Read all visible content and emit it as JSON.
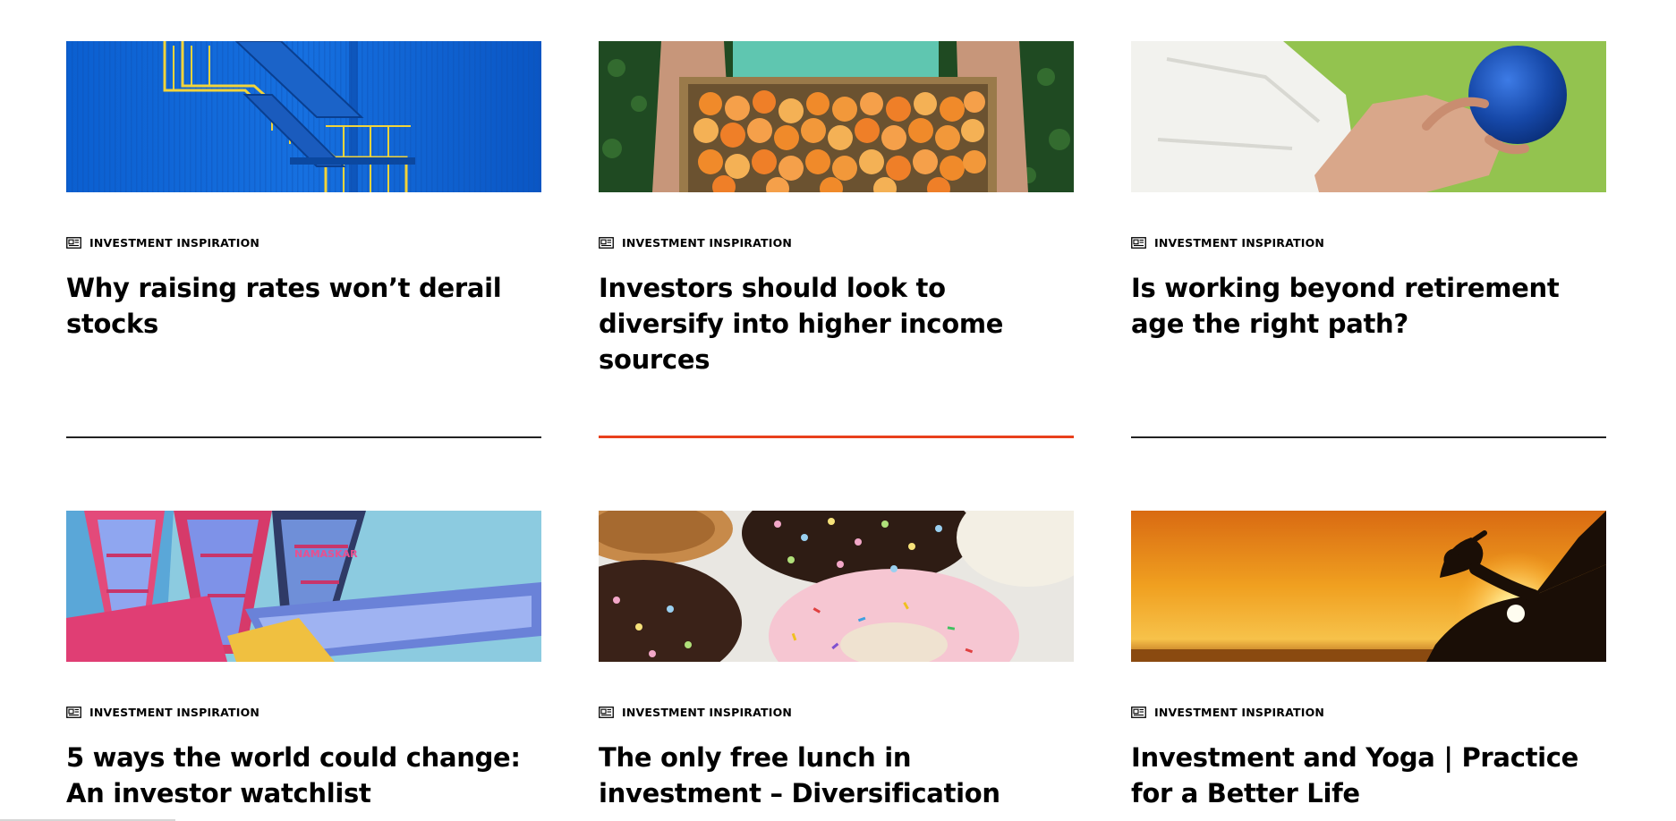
{
  "articles": [
    {
      "category": "INVESTMENT INSPIRATION",
      "title": "Why raising rates won’t derail stocks",
      "image": "blue-staircase-image",
      "active": false
    },
    {
      "category": "INVESTMENT INSPIRATION",
      "title": "Investors should look to diversify into higher income sources",
      "image": "apricot-crate-image",
      "active": true
    },
    {
      "category": "INVESTMENT INSPIRATION",
      "title": "Is working beyond retirement age the right path?",
      "image": "bowling-ball-image",
      "active": false
    },
    {
      "category": "INVESTMENT INSPIRATION",
      "title": "5 ways the world could change: An investor watchlist",
      "image": "rowing-boats-image"
    },
    {
      "category": "INVESTMENT INSPIRATION",
      "title": "The only free lunch in investment – Diversification",
      "image": "sprinkle-donuts-image"
    },
    {
      "category": "INVESTMENT INSPIRATION",
      "title": "Investment and Yoga | Practice for a Better Life",
      "image": "yoga-sunset-image"
    }
  ],
  "colors": {
    "accent": "#e8401c",
    "divider": "#222222",
    "text": "#000000"
  },
  "icons": {
    "category": "newspaper-icon"
  }
}
